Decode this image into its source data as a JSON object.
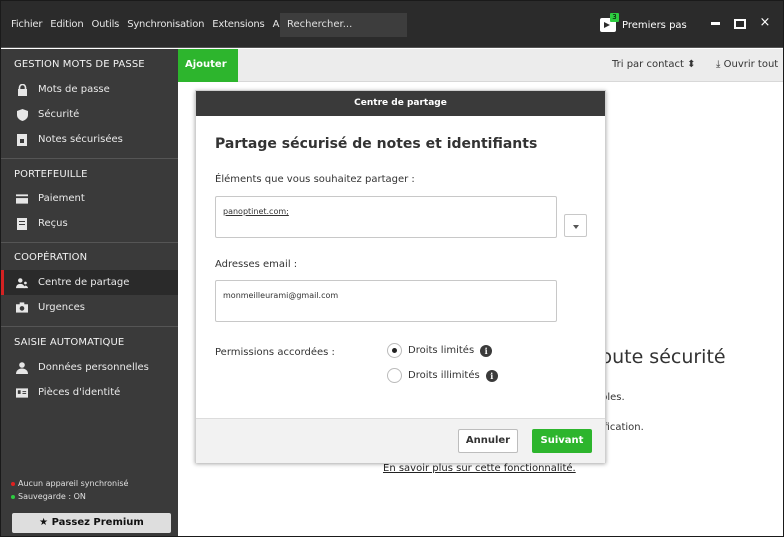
{
  "menu": {
    "items": [
      "Fichier",
      "Edition",
      "Outils",
      "Synchronisation",
      "Extensions",
      "Aide"
    ],
    "search_placeholder": "Rechercher...",
    "premiers_pas_label": "Premiers pas",
    "premiers_pas_badge": "3"
  },
  "window_controls": {
    "close_label": "×"
  },
  "sidebar": {
    "sections": [
      {
        "title": "GESTION MOTS DE PASSE",
        "items": [
          {
            "label": "Mots de passe",
            "icon": "lock-icon"
          },
          {
            "label": "Sécurité",
            "icon": "shield-icon"
          },
          {
            "label": "Notes sécurisées",
            "icon": "note-icon"
          }
        ]
      },
      {
        "title": "PORTEFEUILLE",
        "items": [
          {
            "label": "Paiement",
            "icon": "card-icon"
          },
          {
            "label": "Reçus",
            "icon": "receipt-icon"
          }
        ]
      },
      {
        "title": "COOPÉRATION",
        "items": [
          {
            "label": "Centre de partage",
            "icon": "users-icon",
            "active": true
          },
          {
            "label": "Urgences",
            "icon": "camera-icon"
          }
        ]
      },
      {
        "title": "SAISIE AUTOMATIQUE",
        "items": [
          {
            "label": "Données personnelles",
            "icon": "person-icon"
          },
          {
            "label": "Pièces d'identité",
            "icon": "id-card-icon"
          }
        ]
      }
    ],
    "status_sync": "Aucun appareil synchronisé",
    "status_backup": "Sauvegarde : ON",
    "premium_label": "Passez Premium",
    "colors": {
      "sync_dot": "#e02020",
      "backup_dot": "#2ecc40"
    }
  },
  "toolbar": {
    "add_label": "Ajouter",
    "sort_label": "Tri par contact",
    "open_all_label": "Ouvrir tout"
  },
  "background": {
    "heading_fragment": "toute sécurité",
    "line1_fragment": "ples.",
    "line2_fragment": "lification.",
    "learn_more": "En savoir plus sur cette fonctionnalité."
  },
  "modal": {
    "header": "Centre de partage",
    "title": "Partage sécurisé de notes et identifiants",
    "items_label": "Éléments que vous souhaitez partager :",
    "items_value": "panoptinet.com;",
    "emails_label": "Adresses email :",
    "emails_value": "monmeilleurami@gmail.com",
    "permissions_label": "Permissions accordées :",
    "option_limited": "Droits limités",
    "option_unlimited": "Droits illimités",
    "selected_option": "limited",
    "cancel_label": "Annuler",
    "next_label": "Suivant"
  },
  "colors": {
    "accent": "#2db52d",
    "active_marker": "#d32222",
    "sidebar_bg": "#3a3a3a"
  }
}
